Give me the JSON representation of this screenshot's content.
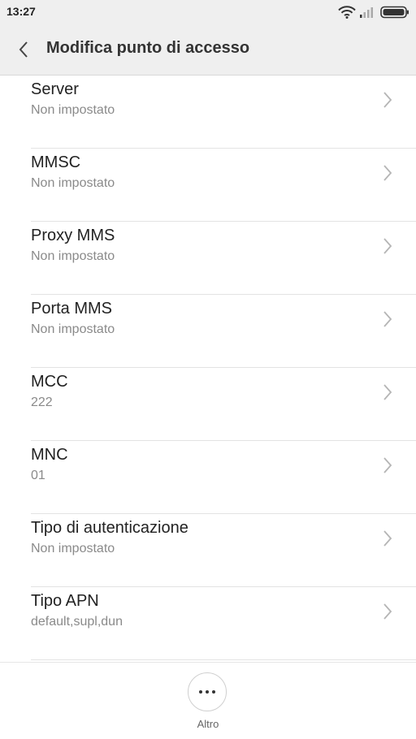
{
  "status_bar": {
    "time": "13:27",
    "icons": [
      "wifi-icon",
      "signal-icon",
      "battery-icon"
    ]
  },
  "header": {
    "back_icon": "chevron-left-icon",
    "title": "Modifica punto di accesso"
  },
  "settings": [
    {
      "title": "Server",
      "value": "Non impostato"
    },
    {
      "title": "MMSC",
      "value": "Non impostato"
    },
    {
      "title": "Proxy MMS",
      "value": "Non impostato"
    },
    {
      "title": "Porta MMS",
      "value": "Non impostato"
    },
    {
      "title": "MCC",
      "value": "222"
    },
    {
      "title": "MNC",
      "value": "01"
    },
    {
      "title": "Tipo di autenticazione",
      "value": "Non impostato"
    },
    {
      "title": "Tipo APN",
      "value": "default,supl,dun"
    }
  ],
  "bottom_bar": {
    "more_icon": "more-horizontal-icon",
    "more_label": "Altro"
  }
}
